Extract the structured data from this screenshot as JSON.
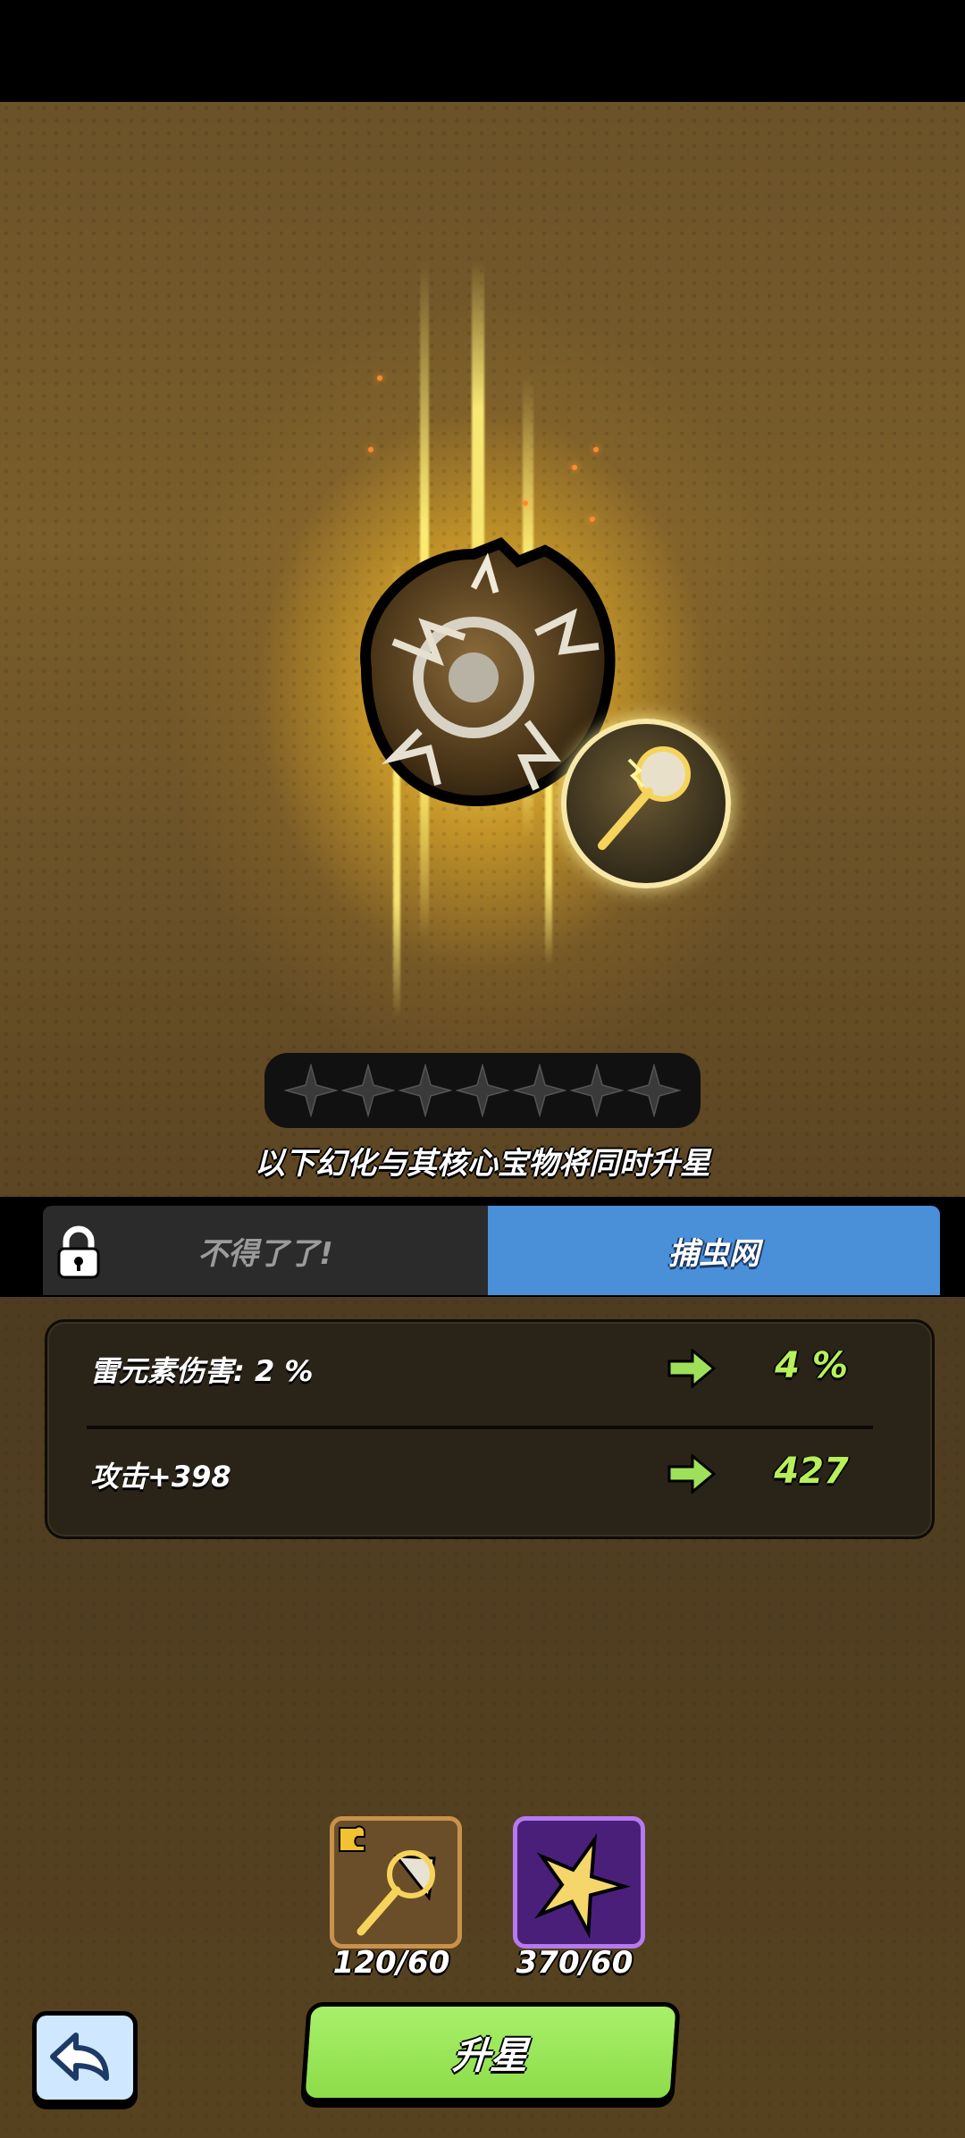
{
  "notice": "以下幻化与其核心宝物将同时升星",
  "stars": {
    "filled": 0,
    "total": 7
  },
  "tabs": [
    {
      "label": "不得了了!",
      "locked": true,
      "active": false
    },
    {
      "label": "捕虫网",
      "locked": false,
      "active": true
    }
  ],
  "stats": [
    {
      "label": "雷元素伤害: 2 %",
      "next": "4 %"
    },
    {
      "label": "攻击+398",
      "next": "427"
    }
  ],
  "materials": [
    {
      "icon": "bug-net-shard-icon",
      "count": "120/60"
    },
    {
      "icon": "gold-star-icon",
      "count": "370/60"
    }
  ],
  "buttons": {
    "upgrade": "升星"
  },
  "colors": {
    "accent_green": "#b7f05a",
    "tab_active": "#4a90d9",
    "button_green": "#8ddc4a"
  }
}
